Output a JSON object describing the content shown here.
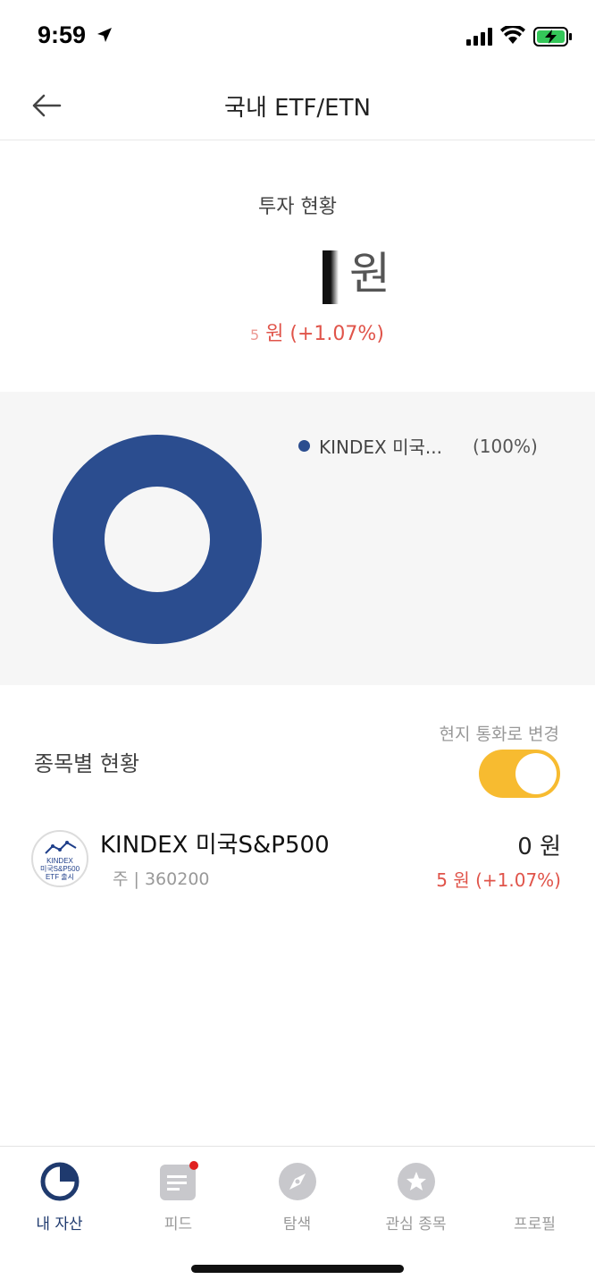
{
  "status_bar": {
    "time": "9:59"
  },
  "header": {
    "title": "국내 ETF/ETN"
  },
  "summary": {
    "label": "투자 현황",
    "amount_suffix": "원",
    "change_text": "원 (+1.07%)",
    "change_prefix": "5"
  },
  "chart_data": {
    "type": "pie",
    "categories": [
      "KINDEX 미국..."
    ],
    "values": [
      100
    ],
    "legend": [
      {
        "name": "KINDEX 미국...",
        "percent": "(100%)",
        "color": "#2b4d8f"
      }
    ],
    "donut": true,
    "color": "#2b4d8f"
  },
  "holdings": {
    "title": "종목별 현황",
    "currency_toggle_label": "현지 통화로 변경",
    "currency_toggle_on": true,
    "items": [
      {
        "logo_lines": [
          "KINDEX",
          "미국S&P500",
          "ETF 출시"
        ],
        "name": "KINDEX 미국S&P500",
        "sub": "주 | 360200",
        "value": "0 원",
        "change": "5 원 (+1.07%)"
      }
    ]
  },
  "tab_bar": {
    "tabs": [
      {
        "label": "내 자산",
        "icon": "pie-chart-icon",
        "active": true
      },
      {
        "label": "피드",
        "icon": "feed-icon",
        "badge": true
      },
      {
        "label": "탐색",
        "icon": "compass-icon"
      },
      {
        "label": "관심 종목",
        "icon": "star-icon"
      },
      {
        "label": "프로필",
        "icon": "profile-icon"
      }
    ]
  },
  "colors": {
    "accent_navy": "#2b4d8f",
    "negative_red": "#e0544a",
    "toggle_yellow": "#f7bb30"
  }
}
